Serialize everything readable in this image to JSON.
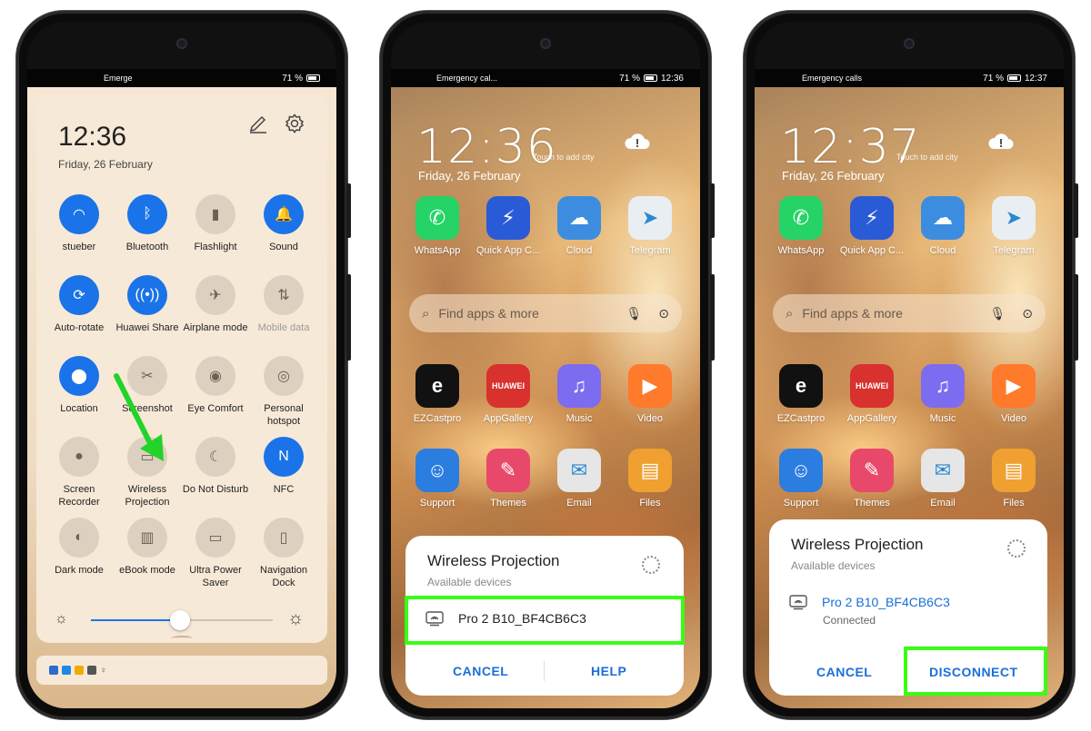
{
  "phone1": {
    "status_left": "Emerge",
    "status_right": "71 %",
    "time": "12:36",
    "date": "Friday, 26 February",
    "edit_icon": "pencil-icon",
    "settings_icon": "gear-icon",
    "tiles": [
      {
        "label": "stueber",
        "icon": "wifi-icon",
        "on": true
      },
      {
        "label": "Bluetooth",
        "icon": "bluetooth-icon",
        "on": true
      },
      {
        "label": "Flashlight",
        "icon": "flashlight-icon",
        "on": false
      },
      {
        "label": "Sound",
        "icon": "bell-icon",
        "on": true
      },
      {
        "label": "Auto-rotate",
        "icon": "rotate-icon",
        "on": true
      },
      {
        "label": "Huawei Share",
        "icon": "share-icon",
        "on": true
      },
      {
        "label": "Airplane mode",
        "icon": "airplane-icon",
        "on": false
      },
      {
        "label": "Mobile data",
        "icon": "mobile-data-icon",
        "on": false,
        "dim": true
      },
      {
        "label": "Location",
        "icon": "location-icon",
        "on": true
      },
      {
        "label": "Screenshot",
        "icon": "screenshot-icon",
        "on": false
      },
      {
        "label": "Eye Comfort",
        "icon": "eye-icon",
        "on": false
      },
      {
        "label": "Personal hotspot",
        "icon": "hotspot-icon",
        "on": false
      },
      {
        "label": "Screen Recorder",
        "icon": "recorder-icon",
        "on": false
      },
      {
        "label": "Wireless Projection",
        "icon": "projection-icon",
        "on": false
      },
      {
        "label": "Do Not Disturb",
        "icon": "moon-icon",
        "on": false
      },
      {
        "label": "NFC",
        "icon": "nfc-icon",
        "on": true
      },
      {
        "label": "Dark mode",
        "icon": "dark-mode-icon",
        "on": false
      },
      {
        "label": "eBook mode",
        "icon": "book-icon",
        "on": false
      },
      {
        "label": "Ultra Power Saver",
        "icon": "battery-icon",
        "on": false
      },
      {
        "label": "Navigation Dock",
        "icon": "dock-icon",
        "on": false
      }
    ],
    "brightness": 0.49
  },
  "phone2": {
    "status_left": "Emergency cal...",
    "status_right": "71 %",
    "status_time": "12:36",
    "time": "12:36",
    "date": "Friday, 26 February",
    "city_hint": "Touch to add city",
    "search_placeholder": "Find apps & more",
    "dialog": {
      "title": "Wireless Projection",
      "subtitle": "Available devices",
      "device": "Pro 2 B10_BF4CB6C3",
      "cancel": "CANCEL",
      "help": "HELP"
    }
  },
  "phone3": {
    "status_left": "Emergency calls",
    "status_right": "71 %",
    "status_time": "12:37",
    "time": "12:37",
    "date": "Friday, 26 February",
    "city_hint": "Touch to add city",
    "search_placeholder": "Find apps & more",
    "dialog": {
      "title": "Wireless Projection",
      "subtitle": "Available devices",
      "device": "Pro 2 B10_BF4CB6C3",
      "device_status": "Connected",
      "cancel": "CANCEL",
      "disconnect": "DISCONNECT"
    }
  },
  "apps": [
    {
      "name": "WhatsApp",
      "icon": "whatsapp-icon",
      "color": "#25d366"
    },
    {
      "name": "Quick App C...",
      "icon": "quick-app-icon",
      "color": "#2a5bd7"
    },
    {
      "name": "Cloud",
      "icon": "cloud-icon",
      "color": "#3c8de0"
    },
    {
      "name": "Telegram",
      "icon": "telegram-icon",
      "color": "#e9eef2"
    },
    {
      "name": "EZCastpro",
      "icon": "ezcast-icon",
      "color": "#111111"
    },
    {
      "name": "AppGallery",
      "icon": "appgallery-icon",
      "color": "#d8312e"
    },
    {
      "name": "Music",
      "icon": "music-icon",
      "color": "#7c6cf0"
    },
    {
      "name": "Video",
      "icon": "video-icon",
      "color": "#ff7a2a"
    },
    {
      "name": "Support",
      "icon": "support-icon",
      "color": "#2b7de0"
    },
    {
      "name": "Themes",
      "icon": "themes-icon",
      "color": "#e8486a"
    },
    {
      "name": "Email",
      "icon": "email-icon",
      "color": "#e6e6e6"
    },
    {
      "name": "Files",
      "icon": "files-icon",
      "color": "#f0a030"
    }
  ],
  "apps_p3_names": [
    "WhatsApp",
    "Quick App C...",
    "Cloud",
    "Telegram",
    "EZCastpro",
    "AppGallery",
    "Music",
    "Video",
    "Support",
    "Themes",
    "Email",
    "Files"
  ],
  "colors": {
    "accent": "#1a73e8",
    "highlight": "#39ff14"
  }
}
